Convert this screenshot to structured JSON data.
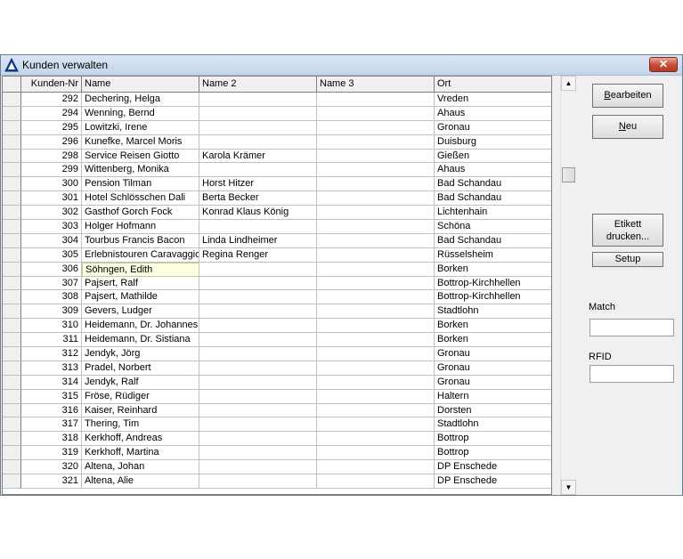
{
  "window": {
    "title": "Kunden verwalten",
    "close_glyph": "✕",
    "icon": "triangle-app-icon"
  },
  "table": {
    "columns": [
      "Kunden-Nr",
      "Name",
      "Name 2",
      "Name 3",
      "Ort"
    ],
    "rows": [
      {
        "nr": "292",
        "name": "Dechering, Helga",
        "name2": "",
        "name3": "",
        "ort": "Vreden"
      },
      {
        "nr": "294",
        "name": "Wenning, Bernd",
        "name2": "",
        "name3": "",
        "ort": "Ahaus"
      },
      {
        "nr": "295",
        "name": "Lowitzki, Irene",
        "name2": "",
        "name3": "",
        "ort": "Gronau"
      },
      {
        "nr": "296",
        "name": "Kunefke, Marcel Moris",
        "name2": "",
        "name3": "",
        "ort": "Duisburg"
      },
      {
        "nr": "298",
        "name": "Service Reisen Giotto",
        "name2": "Karola Krämer",
        "name3": "",
        "ort": "Gießen"
      },
      {
        "nr": "299",
        "name": "Wittenberg, Monika",
        "name2": "",
        "name3": "",
        "ort": "Ahaus"
      },
      {
        "nr": "300",
        "name": "Pension Tilman",
        "name2": "Horst Hitzer",
        "name3": "",
        "ort": "Bad Schandau"
      },
      {
        "nr": "301",
        "name": "Hotel Schlösschen Dali",
        "name2": "Berta Becker",
        "name3": "",
        "ort": "Bad Schandau"
      },
      {
        "nr": "302",
        "name": "Gasthof Gorch Fock",
        "name2": "Konrad Klaus König",
        "name3": "",
        "ort": "Lichtenhain"
      },
      {
        "nr": "303",
        "name": "Holger Hofmann",
        "name2": "",
        "name3": "",
        "ort": "Schöna"
      },
      {
        "nr": "304",
        "name": "Tourbus Francis Bacon",
        "name2": "Linda Lindheimer",
        "name3": "",
        "ort": "Bad Schandau"
      },
      {
        "nr": "305",
        "name": "Erlebnistouren Caravaggio",
        "name2": "Regina Renger",
        "name3": "",
        "ort": "Rüsselsheim"
      },
      {
        "nr": "306",
        "name": "Söhngen, Edith",
        "name2": "",
        "name3": "",
        "ort": "Borken"
      },
      {
        "nr": "307",
        "name": "Pajsert, Ralf",
        "name2": "",
        "name3": "",
        "ort": "Bottrop-Kirchhellen"
      },
      {
        "nr": "308",
        "name": "Pajsert, Mathilde",
        "name2": "",
        "name3": "",
        "ort": "Bottrop-Kirchhellen"
      },
      {
        "nr": "309",
        "name": "Gevers, Ludger",
        "name2": "",
        "name3": "",
        "ort": "Stadtlohn"
      },
      {
        "nr": "310",
        "name": "Heidemann, Dr. Johannes",
        "name2": "",
        "name3": "",
        "ort": "Borken"
      },
      {
        "nr": "311",
        "name": "Heidemann, Dr. Sistiana",
        "name2": "",
        "name3": "",
        "ort": "Borken"
      },
      {
        "nr": "312",
        "name": "Jendyk, Jörg",
        "name2": "",
        "name3": "",
        "ort": "Gronau"
      },
      {
        "nr": "313",
        "name": "Pradel, Norbert",
        "name2": "",
        "name3": "",
        "ort": "Gronau"
      },
      {
        "nr": "314",
        "name": "Jendyk, Ralf",
        "name2": "",
        "name3": "",
        "ort": "Gronau"
      },
      {
        "nr": "315",
        "name": "Fröse, Rüdiger",
        "name2": "",
        "name3": "",
        "ort": "Haltern"
      },
      {
        "nr": "316",
        "name": "Kaiser, Reinhard",
        "name2": "",
        "name3": "",
        "ort": "Dorsten"
      },
      {
        "nr": "317",
        "name": "Thering, Tim",
        "name2": "",
        "name3": "",
        "ort": "Stadtlohn"
      },
      {
        "nr": "318",
        "name": "Kerkhoff, Andreas",
        "name2": "",
        "name3": "",
        "ort": "Bottrop"
      },
      {
        "nr": "319",
        "name": "Kerkhoff, Martina",
        "name2": "",
        "name3": "",
        "ort": "Bottrop"
      },
      {
        "nr": "320",
        "name": "Altena, Johan",
        "name2": "",
        "name3": "",
        "ort": "DP Enschede"
      },
      {
        "nr": "321",
        "name": "Altena, Alie",
        "name2": "",
        "name3": "",
        "ort": "DP Enschede"
      }
    ],
    "focused_row": 12
  },
  "buttons": {
    "bearbeiten_pre": "",
    "bearbeiten_key": "B",
    "bearbeiten_post": "earbeiten",
    "neu_pre": "",
    "neu_key": "N",
    "neu_post": "eu",
    "etikett_line1": "Etikett",
    "etikett_line2": "drucken...",
    "setup": "Setup"
  },
  "fields": {
    "match_label": "Match",
    "match_value": "",
    "rfid_label": "RFID",
    "rfid_value": ""
  },
  "scrollbar": {
    "up_glyph": "▲",
    "down_glyph": "▼"
  }
}
